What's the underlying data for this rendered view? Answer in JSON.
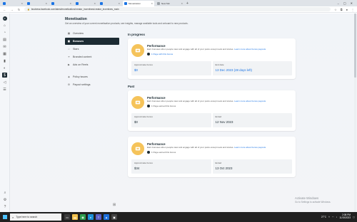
{
  "browser": {
    "tabs": [
      {
        "label": "",
        "icon_color": "#1b74e4"
      },
      {
        "label": "",
        "icon_color": "#1b74e4"
      },
      {
        "label": "",
        "icon_color": "#1b74e4"
      },
      {
        "label": "",
        "icon_color": "#1b74e4"
      },
      {
        "label": "",
        "icon_color": "#1b74e4"
      },
      {
        "label": "Monetization",
        "icon_color": "#1b74e4",
        "active": true
      },
      {
        "label": "New Tab",
        "icon_color": "#9aa0a6"
      }
    ],
    "new_tab_glyph": "+",
    "url": "business.facebook.com/latest/monetization/creator_incentives/creator_incentives_main",
    "controls": {
      "minimize": "–",
      "maximize": "▢",
      "close": "✕"
    }
  },
  "page": {
    "title": "Monetisation",
    "description": "Get an overview of your current monetisation products, see insights, manage available tools and onboard to new products."
  },
  "sidenav": {
    "items": [
      {
        "label": "Overview",
        "icon": "grid-icon"
      },
      {
        "label": "Bonuses",
        "icon": "bonus-icon",
        "active": true
      },
      {
        "label": "Stars",
        "icon": "star-icon"
      },
      {
        "label": "Branded content",
        "icon": "handshake-icon"
      },
      {
        "label": "Ads on Reels",
        "icon": "reels-icon"
      },
      {
        "label": "Policy issues",
        "icon": "shield-icon"
      },
      {
        "label": "Payout settings",
        "icon": "gear-icon"
      }
    ]
  },
  "sections": {
    "in_progress": "In progress",
    "past": "Past"
  },
  "cards": [
    {
      "title": "Performance",
      "description": "Earn bonuses when people view and engage with all of your posts except reels and stories.",
      "link": "Learn more about bonus payouts",
      "page_text": "1 Page with this bonus",
      "stat1_label": "Approximate bonus",
      "stat1_value": "$0",
      "stat2_label": "End date",
      "stat2_value": "13 Dec 2023 (28 days left)"
    },
    {
      "title": "Performance",
      "description": "Earn bonuses when people view and engage with all of your posts except reels and stories.",
      "link": "Learn more about bonus payouts",
      "page_text": "1 Page earned this bonus",
      "stat1_label": "Approximate bonus",
      "stat1_value": "$0",
      "stat2_label": "Ended",
      "stat2_value": "12 Nov 2023"
    },
    {
      "title": "Performance",
      "description": "Earn bonuses when people view and engage with all of your posts except reels and stories.",
      "link": "Learn more about bonus payouts",
      "page_text": "1 Page earned this bonus",
      "stat1_label": "Approximate bonus",
      "stat1_value": "$34",
      "stat2_label": "Ended",
      "stat2_value": "13 Oct 2023"
    }
  ],
  "watermark": {
    "line1": "Activate Windows",
    "line2": "Go to Settings to activate Windows."
  },
  "taskbar": {
    "search_placeholder": "Type here to search",
    "time": "2:08 PM",
    "date": "11/15/2023",
    "weather": "27°C"
  },
  "colors": {
    "accent": "#1b74e4",
    "nav_active": "#1c2b33",
    "bonus_icon": "#f5c35a"
  }
}
